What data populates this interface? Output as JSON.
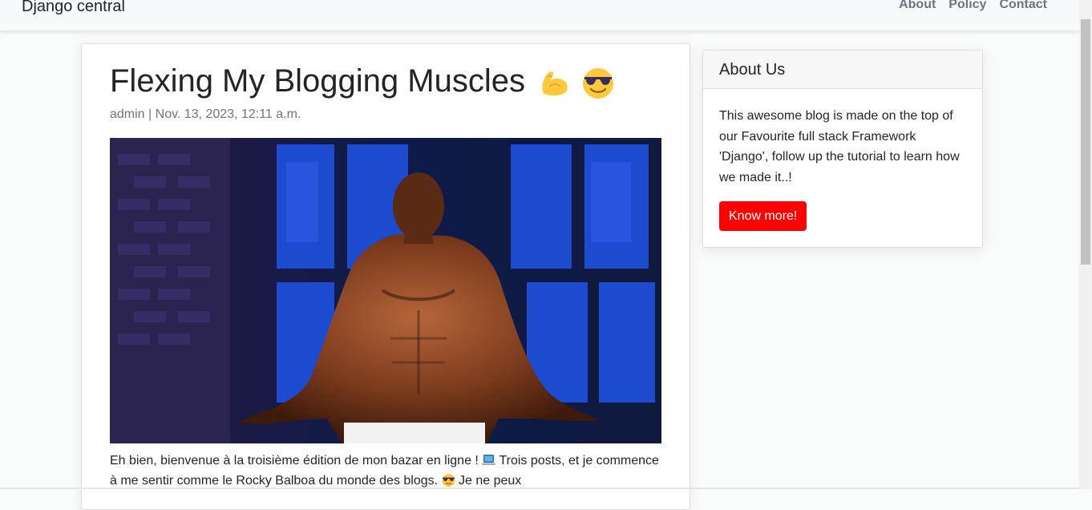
{
  "navbar": {
    "brand": "Django central",
    "links": [
      "About",
      "Policy",
      "Contact"
    ]
  },
  "post": {
    "title": "Flexing My Blogging Muscles",
    "title_emojis": [
      "flexed-biceps-icon",
      "smiling-face-with-sunglasses-icon"
    ],
    "author": "admin",
    "separator": "|",
    "date": "Nov. 13, 2023, 12:11 a.m.",
    "image_alt": "Muscular man flexing on stage",
    "body_part1": "Eh bien, bienvenue à la troisième édition de mon bazar en ligne ! ",
    "body_part2": " Trois posts, et je commence à me sentir comme le Rocky Balboa du monde des blogs. ",
    "body_part3": " Je ne peux"
  },
  "sidebar": {
    "title": "About Us",
    "text": "This awesome blog is made on the top of our Favourite full stack Framework 'Django', follow up the tutorial to learn how we made it..!",
    "button_label": "Know more!",
    "button_color": "#ff0000"
  }
}
